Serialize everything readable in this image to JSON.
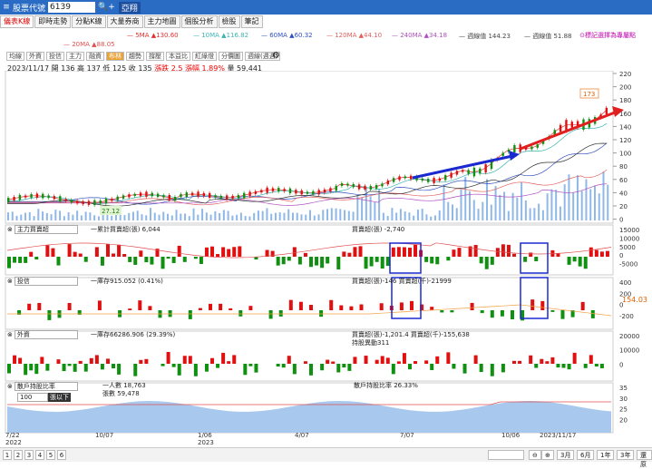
{
  "topbar": {
    "label": "股票代號",
    "code": "6139",
    "search_icon": "search-icon",
    "stock_name": "亞翔"
  },
  "tabs": [
    "儀表K線",
    "即時走勢",
    "分點K線",
    "大量券商",
    "主力地圖",
    "個股分析",
    "檢股",
    "筆記"
  ],
  "ma_legend": [
    {
      "label": "5MA ▲130.60",
      "color": "#e03030"
    },
    {
      "label": "10MA ▲116.82",
      "color": "#3cb4b4"
    },
    {
      "label": "60MA ▲60.32",
      "color": "#3050c0"
    },
    {
      "label": "120MA ▲44.10",
      "color": "#e06060"
    },
    {
      "label": "240MA ▲34.18",
      "color": "#b050c0"
    },
    {
      "label": "週線值 144.23",
      "color": "#444"
    },
    {
      "label": "週線值 51.88",
      "color": "#444"
    },
    {
      "label": "20MA ▲88.05",
      "color": "#e05050"
    }
  ],
  "selection_note": "⊙標記選擇為專屬點",
  "toolbar": [
    "均線",
    "外資",
    "投信",
    "主力",
    "融資",
    "布林",
    "趨勢",
    "撐壓",
    "本益比",
    "紅綠燈",
    "分價圖",
    "週線(週週)"
  ],
  "ohlc": {
    "date": "2023/11/17",
    "open_label": "開",
    "open": "136",
    "high_label": "高",
    "high": "137",
    "low_label": "低",
    "low": "125",
    "close_label": "收",
    "close": "135",
    "change": "漲跌 2.5",
    "pct": "漲幅 1.89%",
    "vol": "量 59,441"
  },
  "price_axis": [
    "220",
    "200",
    "180",
    "160",
    "140",
    "120",
    "100",
    "80",
    "60",
    "40",
    "20",
    "0"
  ],
  "callouts": {
    "high": "173",
    "low": "27.12"
  },
  "panel1": {
    "select": "主力買賣超",
    "left_text": "一累計買賣超(張) 6,044",
    "right_text": "買賣超(張) -2,740",
    "axis": [
      "15000",
      "10000",
      "5000",
      "0",
      "-5000"
    ]
  },
  "panel2": {
    "select": "投信",
    "left_text": "一庫存915.052 (0.41%)",
    "right_text": "買賣超(張)-146 買賣超(千)-21999",
    "axis": [
      "400",
      "200",
      "0",
      "-200"
    ],
    "last_value": "154.03"
  },
  "panel3": {
    "select": "外資",
    "left_text": "一庫存66286.906 (29.39%)",
    "right_text": "買賣超(張)-1,201.4 買賣超(千)-155,638",
    "right_text2": "持股異動311",
    "axis": [
      "20000",
      "10000",
      "0"
    ]
  },
  "panel4": {
    "select": "散戶持股比率",
    "sub_value": "100",
    "sub_label": "張以下",
    "left_text": "一人數 18,763",
    "left_text2": "張數 59,478",
    "right_text": "散戶持股比率 26.33%",
    "axis": [
      "35",
      "30",
      "25",
      "20"
    ]
  },
  "x_axis": [
    {
      "label": "7/22",
      "sub": "2022"
    },
    {
      "label": "10/07",
      "sub": ""
    },
    {
      "label": "1/06",
      "sub": "2023"
    },
    {
      "label": "4/07",
      "sub": ""
    },
    {
      "label": "7/07",
      "sub": ""
    },
    {
      "label": "10/06",
      "sub": ""
    },
    {
      "label": "2023/11/17",
      "sub": ""
    }
  ],
  "pages": [
    "1",
    "2",
    "3",
    "4",
    "5",
    "6"
  ],
  "ranges": [
    "3月",
    "6月",
    "1年",
    "3年",
    "還原"
  ],
  "colors": {
    "up": "#e01010",
    "down": "#109010",
    "annot_red": "#e02020",
    "annot_blue": "#1a2ad0"
  }
}
